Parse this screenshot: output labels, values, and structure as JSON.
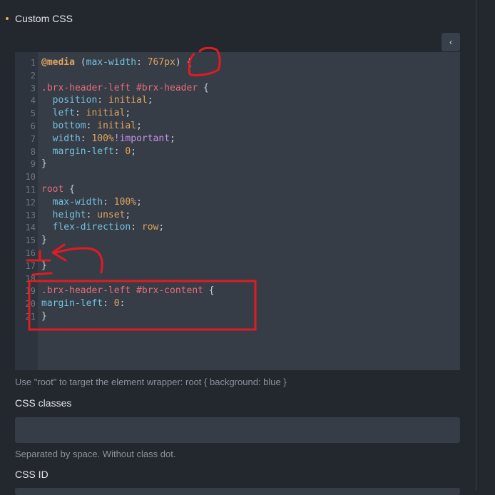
{
  "section": {
    "title": "Custom CSS",
    "dot_color": "#e0b24a"
  },
  "collapse_button": {
    "glyph": "‹"
  },
  "editor": {
    "lines": [
      {
        "n": "1",
        "tokens": [
          [
            "at",
            "@media"
          ],
          [
            "punc",
            " ("
          ],
          [
            "prop",
            "max-width"
          ],
          [
            "punc",
            ": "
          ],
          [
            "val",
            "767px"
          ],
          [
            "punc",
            ") {"
          ]
        ]
      },
      {
        "n": "2",
        "tokens": []
      },
      {
        "n": "3",
        "tokens": [
          [
            "sel",
            ".brx-header-left #brx-header"
          ],
          [
            "punc",
            " {"
          ]
        ]
      },
      {
        "n": "4",
        "tokens": [
          [
            "punc",
            "  "
          ],
          [
            "prop",
            "position"
          ],
          [
            "punc",
            ": "
          ],
          [
            "val",
            "initial"
          ],
          [
            "punc",
            ";"
          ]
        ]
      },
      {
        "n": "5",
        "tokens": [
          [
            "punc",
            "  "
          ],
          [
            "prop",
            "left"
          ],
          [
            "punc",
            ": "
          ],
          [
            "val",
            "initial"
          ],
          [
            "punc",
            ";"
          ]
        ]
      },
      {
        "n": "6",
        "tokens": [
          [
            "punc",
            "  "
          ],
          [
            "prop",
            "bottom"
          ],
          [
            "punc",
            ": "
          ],
          [
            "val",
            "initial"
          ],
          [
            "punc",
            ";"
          ]
        ]
      },
      {
        "n": "7",
        "tokens": [
          [
            "punc",
            "  "
          ],
          [
            "prop",
            "width"
          ],
          [
            "punc",
            ": "
          ],
          [
            "val",
            "100%"
          ],
          [
            "imp",
            "!important"
          ],
          [
            "punc",
            ";"
          ]
        ]
      },
      {
        "n": "8",
        "tokens": [
          [
            "punc",
            "  "
          ],
          [
            "prop",
            "margin-left"
          ],
          [
            "punc",
            ": "
          ],
          [
            "val",
            "0"
          ],
          [
            "punc",
            ";"
          ]
        ]
      },
      {
        "n": "9",
        "tokens": [
          [
            "punc",
            "}"
          ]
        ]
      },
      {
        "n": "10",
        "tokens": []
      },
      {
        "n": "11",
        "tokens": [
          [
            "sel",
            "root"
          ],
          [
            "punc",
            " {"
          ]
        ]
      },
      {
        "n": "12",
        "tokens": [
          [
            "punc",
            "  "
          ],
          [
            "prop",
            "max-width"
          ],
          [
            "punc",
            ": "
          ],
          [
            "val",
            "100%"
          ],
          [
            "punc",
            ";"
          ]
        ]
      },
      {
        "n": "13",
        "tokens": [
          [
            "punc",
            "  "
          ],
          [
            "prop",
            "height"
          ],
          [
            "punc",
            ": "
          ],
          [
            "val",
            "unset"
          ],
          [
            "punc",
            ";"
          ]
        ]
      },
      {
        "n": "14",
        "tokens": [
          [
            "punc",
            "  "
          ],
          [
            "prop",
            "flex-direction"
          ],
          [
            "punc",
            ": "
          ],
          [
            "val",
            "row"
          ],
          [
            "punc",
            ";"
          ]
        ]
      },
      {
        "n": "15",
        "tokens": [
          [
            "punc",
            "}"
          ]
        ]
      },
      {
        "n": "16",
        "tokens": []
      },
      {
        "n": "17",
        "tokens": [
          [
            "punc",
            "}"
          ]
        ]
      },
      {
        "n": "18",
        "tokens": []
      },
      {
        "n": "19",
        "tokens": [
          [
            "sel",
            ".brx-header-left #brx-content"
          ],
          [
            "punc",
            " {"
          ]
        ]
      },
      {
        "n": "20",
        "tokens": [
          [
            "prop",
            "margin-left"
          ],
          [
            "punc",
            ": "
          ],
          [
            "val",
            "0"
          ],
          [
            "punc",
            ":"
          ]
        ]
      },
      {
        "n": "21",
        "tokens": [
          [
            "punc",
            "}"
          ]
        ]
      }
    ]
  },
  "help_text": "Use \"root\" to target the element wrapper: root { background: blue }",
  "css_classes": {
    "label": "CSS classes",
    "value": "",
    "help": "Separated by space. Without class dot."
  },
  "css_id": {
    "label": "CSS ID",
    "value": ""
  }
}
